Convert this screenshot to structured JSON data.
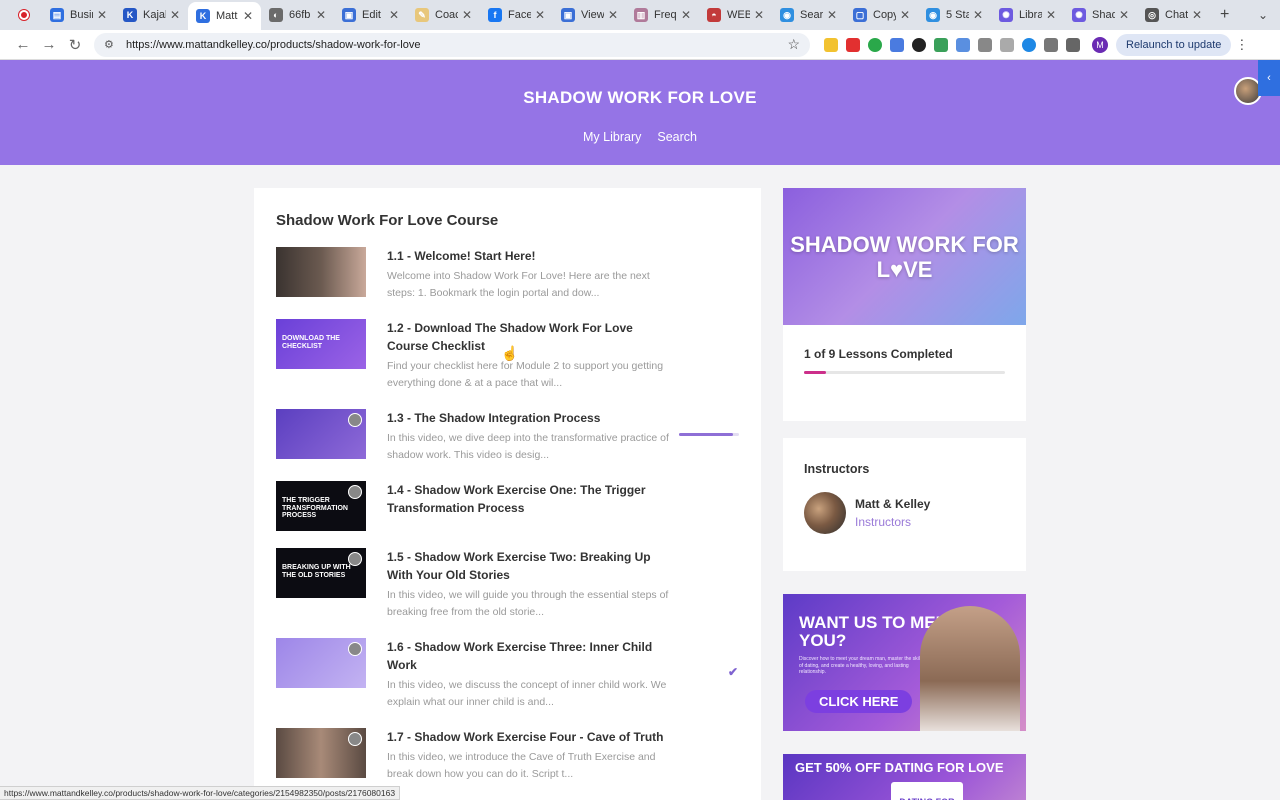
{
  "browser": {
    "tabs": [
      {
        "title": "Busin",
        "color": "#2f6fe0",
        "glyph": "▤"
      },
      {
        "title": "Kajab",
        "color": "#2557c5",
        "glyph": "K"
      },
      {
        "title": "Matt",
        "color": "#2f6fe0",
        "glyph": "K",
        "active": true
      },
      {
        "title": "66fb",
        "color": "#6b6b6b",
        "glyph": "◐"
      },
      {
        "title": "Edit",
        "color": "#3b6fd6",
        "glyph": "▣"
      },
      {
        "title": "Coac",
        "color": "#e8c77b",
        "glyph": "✎"
      },
      {
        "title": "Facel",
        "color": "#1877f2",
        "glyph": "f"
      },
      {
        "title": "View",
        "color": "#3b6fd6",
        "glyph": "▣"
      },
      {
        "title": "Frequ",
        "color": "#b07a9a",
        "glyph": "▥"
      },
      {
        "title": "WEBI",
        "color": "#c23a3a",
        "glyph": "◓"
      },
      {
        "title": "Searc",
        "color": "#2f8fe0",
        "glyph": "◉"
      },
      {
        "title": "Copy",
        "color": "#3b6fd6",
        "glyph": "▢"
      },
      {
        "title": "5 Sta",
        "color": "#2f8fe0",
        "glyph": "◉"
      },
      {
        "title": "Libra",
        "color": "#6d5ae0",
        "glyph": "✺"
      },
      {
        "title": "Shad",
        "color": "#6d5ae0",
        "glyph": "✺"
      },
      {
        "title": "Chat",
        "color": "#555555",
        "glyph": "◎"
      }
    ],
    "new_tab_glyph": "+",
    "url": "https://www.mattandkelley.co/products/shadow-work-for-love",
    "relaunch_label": "Relaunch to update",
    "profile_initial": "M",
    "status_url": "https://www.mattandkelley.co/products/shadow-work-for-love/categories/2154982350/posts/2176080163"
  },
  "site": {
    "title": "SHADOW WORK FOR LOVE",
    "nav": [
      "My Library",
      "Search"
    ]
  },
  "course": {
    "title": "Shadow Work For Love Course",
    "lessons": [
      {
        "title": "1.1 - Welcome! Start Here!",
        "desc": "Welcome into Shadow Work For Love!  Here are the next steps: 1. Bookmark the login portal and dow...",
        "thumb_bg": "linear-gradient(90deg,#3a3330,#6b5a50 50%,#c9a99a)",
        "thumb_text": ""
      },
      {
        "title": "1.2 - Download The Shadow Work For Love Course Checklist",
        "desc": "Find your checklist here for Module 2 to support you getting everything done & at a pace that wil...",
        "thumb_bg": "linear-gradient(135deg,#6a40d8,#9b63e6)",
        "thumb_text": "DOWNLOAD THE CHECKLIST"
      },
      {
        "title": "1.3 - The Shadow Integration Process",
        "desc": "In this video, we dive deep into the transformative practice of shadow work. This video is desig...",
        "thumb_bg": "linear-gradient(135deg,#5b3fc0,#8e6ad8)",
        "thumb_text": "",
        "progress": 0.9
      },
      {
        "title": "1.4 - Shadow Work Exercise One: The Trigger Transformation Process",
        "desc": "",
        "thumb_bg": "#0c0c12",
        "thumb_text": "THE TRIGGER TRANSFORMATION PROCESS"
      },
      {
        "title": "1.5 - Shadow Work Exercise Two: Breaking Up With Your Old Stories",
        "desc": "In this video, we will guide you through the essential steps of breaking free from the old storie...",
        "thumb_bg": "#0c0c12",
        "thumb_text": "BREAKING UP WITH THE OLD STORIES"
      },
      {
        "title": "1.6 - Shadow Work Exercise Three: Inner Child Work",
        "desc": "In this video, we discuss the concept of inner child work. We explain what our inner child is and...",
        "thumb_bg": "linear-gradient(135deg,#9d86e8,#c3b3f2)",
        "thumb_text": "",
        "completed": true
      },
      {
        "title": "1.7 - Shadow Work Exercise Four - Cave of Truth",
        "desc": "In this video, we introduce the Cave of Truth Exercise and break down how you can do it. Script t...",
        "thumb_bg": "linear-gradient(90deg,#5a4a42,#a88a78 50%,#5a4a42)",
        "thumb_text": ""
      }
    ]
  },
  "sidebar": {
    "hero_text": "SHADOW WORK FOR L♥VE",
    "progress_label": "1 of 9 Lessons Completed",
    "progress_completed": 1,
    "progress_total": 9,
    "progress_color": "#cc2f8a",
    "instructors_heading": "Instructors",
    "instructor_name": "Matt & Kelley",
    "instructor_role": "Instructors",
    "promo1_head": "WANT US TO MENTOR YOU?",
    "promo1_sub": "Discover how to meet your dream man, master the skill of dating, and create a healthy, loving, and lasting relationship.",
    "promo1_cta": "CLICK HERE",
    "promo2_head": "GET 50% OFF DATING FOR LOVE",
    "promo2_book": "DATING FOR LOVE"
  },
  "colors": {
    "header": "#9574e6",
    "accent": "#8e6fd6"
  }
}
